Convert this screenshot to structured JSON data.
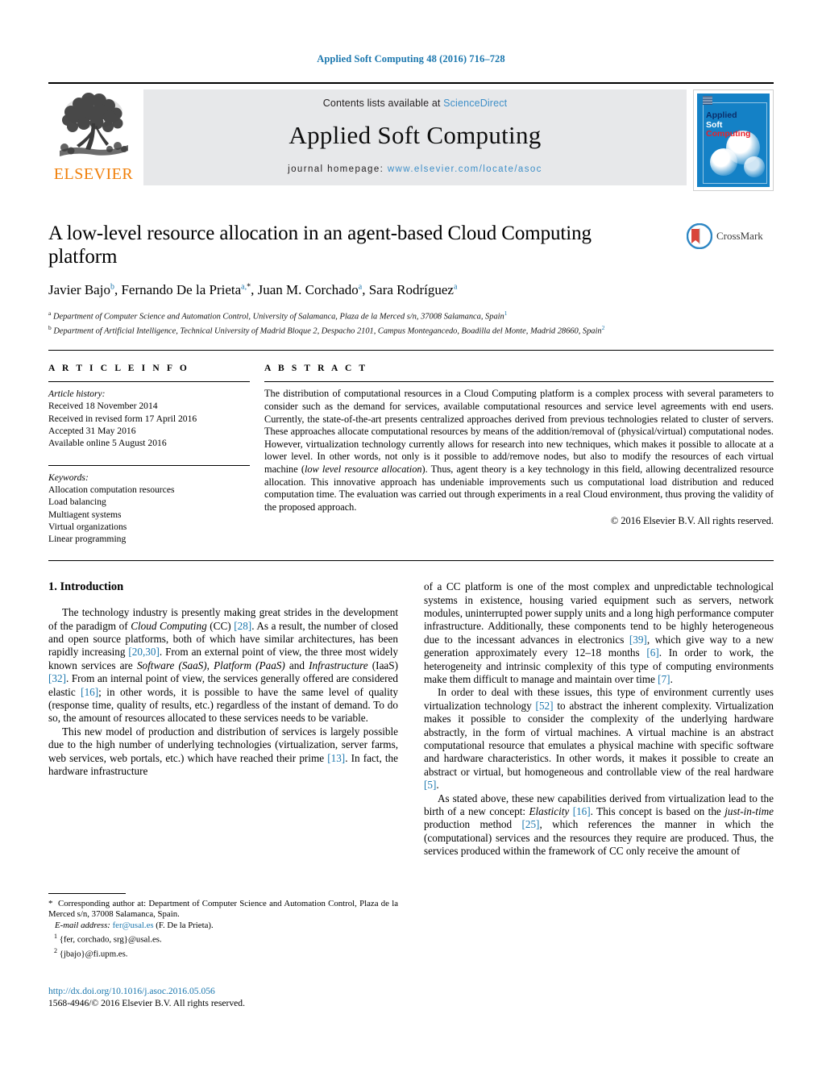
{
  "running_head": "Applied Soft Computing 48 (2016) 716–728",
  "banner": {
    "publisher": "ELSEVIER",
    "contents_prefix": "Contents lists available at ",
    "contents_link": "ScienceDirect",
    "journal_title": "Applied Soft Computing",
    "homepage_prefix": "journal homepage: ",
    "homepage_url": "www.elsevier.com/locate/asoc",
    "cover": {
      "line1": "Applied",
      "line2": "Soft",
      "line3": "Computing"
    }
  },
  "article": {
    "title": "A low-level resource allocation in an agent-based Cloud Computing platform",
    "crossmark_label": "CrossMark",
    "authors_html": "Javier Bajo<sup>b</sup>, Fernando De la Prieta<sup>a,</sup><sup class=\"blk\">*</sup>, Juan M. Corchado<sup>a</sup>, Sara Rodríguez<sup>a</sup>",
    "affiliation_a": "Department of Computer Science and Automation Control, University of Salamanca, Plaza de la Merced s/n, 37008 Salamanca, Spain",
    "affiliation_b": "Department of Artificial Intelligence, Technical University of Madrid Bloque 2, Despacho 2101, Campus Montegancedo, Boadilla del Monte, Madrid 28660, Spain"
  },
  "article_info": {
    "heading": "A R T I C L E  I N F O",
    "history_label": "Article history:",
    "history": [
      "Received 18 November 2014",
      "Received in revised form 17 April 2016",
      "Accepted 31 May 2016",
      "Available online 5 August 2016"
    ],
    "keywords_label": "Keywords:",
    "keywords": [
      "Allocation computation resources",
      "Load balancing",
      "Multiagent systems",
      "Virtual organizations",
      "Linear programming"
    ]
  },
  "abstract": {
    "heading": "A B S T R A C T",
    "text_html": "The distribution of computational resources in a Cloud Computing platform is a complex process with several parameters to consider such as the demand for services, available computational resources and service level agreements with end users. Currently, the state-of-the-art presents centralized approaches derived from previous technologies related to cluster of servers. These approaches allocate computational resources by means of the addition/removal of (physical/virtual) computational nodes. However, virtualization technology currently allows for research into new techniques, which makes it possible to allocate at a lower level. In other words, not only is it possible to add/remove nodes, but also to modify the resources of each virtual machine (<i>low level resource allocation</i>). Thus, agent theory is a key technology in this field, allowing decentralized resource allocation. This innovative approach has undeniable improvements such us computational load distribution and reduced computation time. The evaluation was carried out through experiments in a real Cloud environment, thus proving the validity of the proposed approach.",
    "copyright": "© 2016 Elsevier B.V. All rights reserved."
  },
  "body": {
    "section_heading": "1.  Introduction",
    "left_paragraphs_html": [
      "The technology industry is presently making great strides in the development of the paradigm of <i class=\"ital\">Cloud Computing</i> (CC) <span class=\"cite\">[28]</span>. As a result, the number of closed and open source platforms, both of which have similar architectures, has been rapidly increasing <span class=\"cite\">[20,30]</span>. From an external point of view, the three most widely known services are <i class=\"ital\">Software (SaaS)</i>, <i class=\"ital\">Platform (PaaS)</i> and <i class=\"ital\">Infrastructure</i> (IaaS) <span class=\"cite\">[32]</span>. From an internal point of view, the services generally offered are considered elastic <span class=\"cite\">[16]</span>; in other words, it is possible to have the same level of quality (response time, quality of results, etc.) regardless of the instant of demand. To do so, the amount of resources allocated to these services needs to be variable.",
      "This new model of production and distribution of services is largely possible due to the high number of underlying technologies (virtualization, server farms, web services, web portals, etc.) which have reached their prime <span class=\"cite\">[13]</span>. In fact, the hardware infrastructure"
    ],
    "right_paragraphs_html": [
      "of a CC platform is one of the most complex and unpredictable technological systems in existence, housing varied equipment such as servers, network modules, uninterrupted power supply units and a long high performance computer infrastructure. Additionally, these components tend to be highly heterogeneous due to the incessant advances in electronics <span class=\"cite\">[39]</span>, which give way to a new generation approximately every 12–18 months <span class=\"cite\">[6]</span>. In order to work, the heterogeneity and intrinsic complexity of this type of computing environments make them difficult to manage and maintain over time <span class=\"cite\">[7]</span>.",
      "In order to deal with these issues, this type of environment currently uses virtualization technology <span class=\"cite\">[52]</span> to abstract the inherent complexity. Virtualization makes it possible to consider the complexity of the underlying hardware abstractly, in the form of virtual machines. A virtual machine is an abstract computational resource that emulates a physical machine with specific software and hardware characteristics. In other words, it makes it possible to create an abstract or virtual, but homogeneous and controllable view of the real hardware <span class=\"cite\">[5]</span>.",
      "As stated above, these new capabilities derived from virtualization lead to the birth of a new concept: <i class=\"ital\">Elasticity</i> <span class=\"cite\">[16]</span>. This concept is based on the <i class=\"ital\">just-in-time</i> production method <span class=\"cite\">[25]</span>, which references the manner in which the (computational) services and the resources they require are produced. Thus, the services produced within the framework of CC only receive the amount of"
    ]
  },
  "footnotes": {
    "corresponding_html": "<span class=\"star\">*</span>&nbsp; Corresponding author at: Department of Computer Science and Automation Control, Plaza de la Merced s/n, 37008 Salamanca, Spain.",
    "email_label": "E-mail address:",
    "email": "fer@usal.es",
    "email_person": "(F. De la Prieta).",
    "note1": "{fer, corchado, srg}@usal.es.",
    "note2": "{jbajo}@fi.upm.es.",
    "note1_marker": "1",
    "note2_marker": "2"
  },
  "publication": {
    "doi": "http://dx.doi.org/10.1016/j.asoc.2016.05.056",
    "issn_copyright": "1568-4946/© 2016 Elsevier B.V. All rights reserved."
  },
  "colors": {
    "link_blue": "#1b77ae",
    "banner_grey": "#e7e8ea",
    "elsevier_orange": "#f07f09",
    "cover_blue": "#1481c6",
    "crossmark_red": "#d9453a"
  }
}
